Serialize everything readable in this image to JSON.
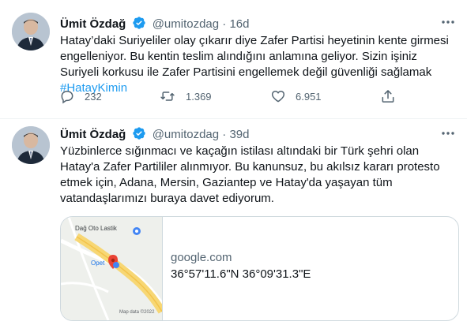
{
  "tweets": [
    {
      "author": {
        "name": "Ümit Özdağ",
        "handle": "@umitozdag"
      },
      "separator": "·",
      "time": "16d",
      "text": "Hatay’daki Suriyeliler olay çıkarır diye Zafer Partisi heyetinin kente girmesi engelleniyor. Bu kentin teslim alındığını anlamına geliyor. Sizin işiniz Suriyeli korkusu ile Zafer Partisini engellemek değil güvenliği sağlamak",
      "hashtag": "#HatayKimin",
      "replies": "232",
      "retweets": "1.369",
      "likes": "6.951"
    },
    {
      "author": {
        "name": "Ümit Özdağ",
        "handle": "@umitozdag"
      },
      "separator": "·",
      "time": "39d",
      "text": "Yüzbinlerce sığınmacı ve kaçağın istilası altındaki bir Türk şehri olan Hatay'a Zafer Partililer alınmıyor. Bu kanunsuz, bu akılsız kararı protesto etmek için, Adana, Mersin, Gaziantep ve Hatay'da yaşayan tüm vatandaşlarımızı buraya davet ediyorum.",
      "card": {
        "domain": "google.com",
        "coordinates": "36°57'11.6\"N 36°09'31.3\"E",
        "map": {
          "place_label": "Dağ Oto Lastik",
          "station_label": "Opet",
          "attribution": "Map data ©2022"
        }
      }
    }
  ],
  "icons": {
    "verified": "verified-badge-icon",
    "more": "more-dots-icon",
    "reply": "reply-icon",
    "retweet": "retweet-icon",
    "like": "heart-icon",
    "share": "share-icon",
    "map_pin": "map-pin-icon"
  },
  "colors": {
    "accent": "#1d9bf0",
    "text": "#0f1419",
    "secondary": "#536471",
    "border": "#cfd9de",
    "map_pin": "#ea4335"
  }
}
